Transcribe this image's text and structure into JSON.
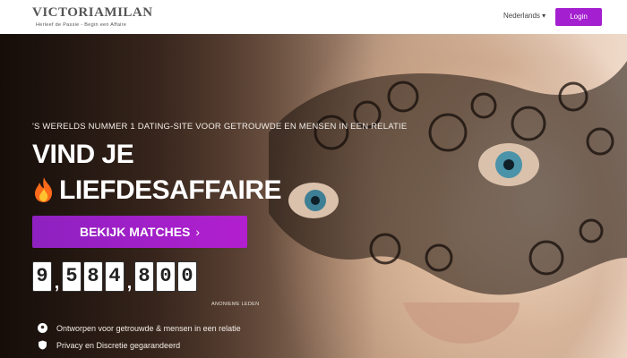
{
  "brand": {
    "name": "VICTORIAMILAN",
    "tagline": "Herleef de Passie - Begin een Affaire"
  },
  "header": {
    "language": "Nederlands ▾",
    "login_label": "Login",
    "accent_color": "#a41fcf"
  },
  "hero": {
    "tagline": "'S WERELDS NUMMER 1 DATING-SITE VOOR GETROUWDE EN MENSEN IN EEN RELATIE",
    "headline_line1": "VIND JE",
    "headline_line2": "LIEFDESAFFAIRE",
    "cta_label": "BEKIJK MATCHES",
    "cta_arrow": "›",
    "member_count_digits": [
      "9",
      "5",
      "8",
      "4",
      "8",
      "0",
      "0"
    ],
    "member_count_separators": [
      ",",
      ",",
      ","
    ],
    "member_label": "ANONIEME LEDEN"
  },
  "features": [
    {
      "icon": "location-pin-icon",
      "text": "Ontworpen voor getrouwde & mensen in een relatie"
    },
    {
      "icon": "shield-icon",
      "text": "Privacy en Discretie gegarandeerd"
    }
  ]
}
